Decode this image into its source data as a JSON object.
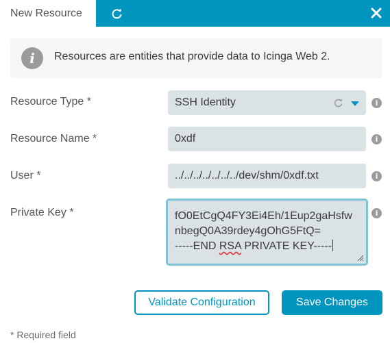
{
  "header": {
    "tab_title": "New Resource",
    "refresh_icon": "refresh-icon",
    "close_icon": "close-icon"
  },
  "info": {
    "icon": "info-icon",
    "text": "Resources are entities that provide data to Icinga Web 2."
  },
  "form": {
    "resource_type": {
      "label": "Resource Type *",
      "value": "SSH Identity"
    },
    "resource_name": {
      "label": "Resource Name *",
      "value": "0xdf"
    },
    "user": {
      "label": "User *",
      "value": "../../../../../../../dev/shm/0xdf.txt"
    },
    "private_key": {
      "label": "Private Key *",
      "lines": [
        "fO0EtCgQ4FY3Ei4Eh/1Eup2gaHsfw",
        "nbegQ0A39rdey4gOhG5FtQ="
      ],
      "last_line_prefix": "-----END ",
      "last_line_flagged": "RSA",
      "last_line_suffix": " PRIVATE KEY-----"
    },
    "help_glyph": "i"
  },
  "buttons": {
    "validate": "Validate Configuration",
    "save": "Save Changes"
  },
  "footer": {
    "required_note": "* Required field"
  },
  "colors": {
    "accent": "#0095bf",
    "field_bg": "#dbe2e5",
    "info_bg": "#f5f6f7"
  }
}
